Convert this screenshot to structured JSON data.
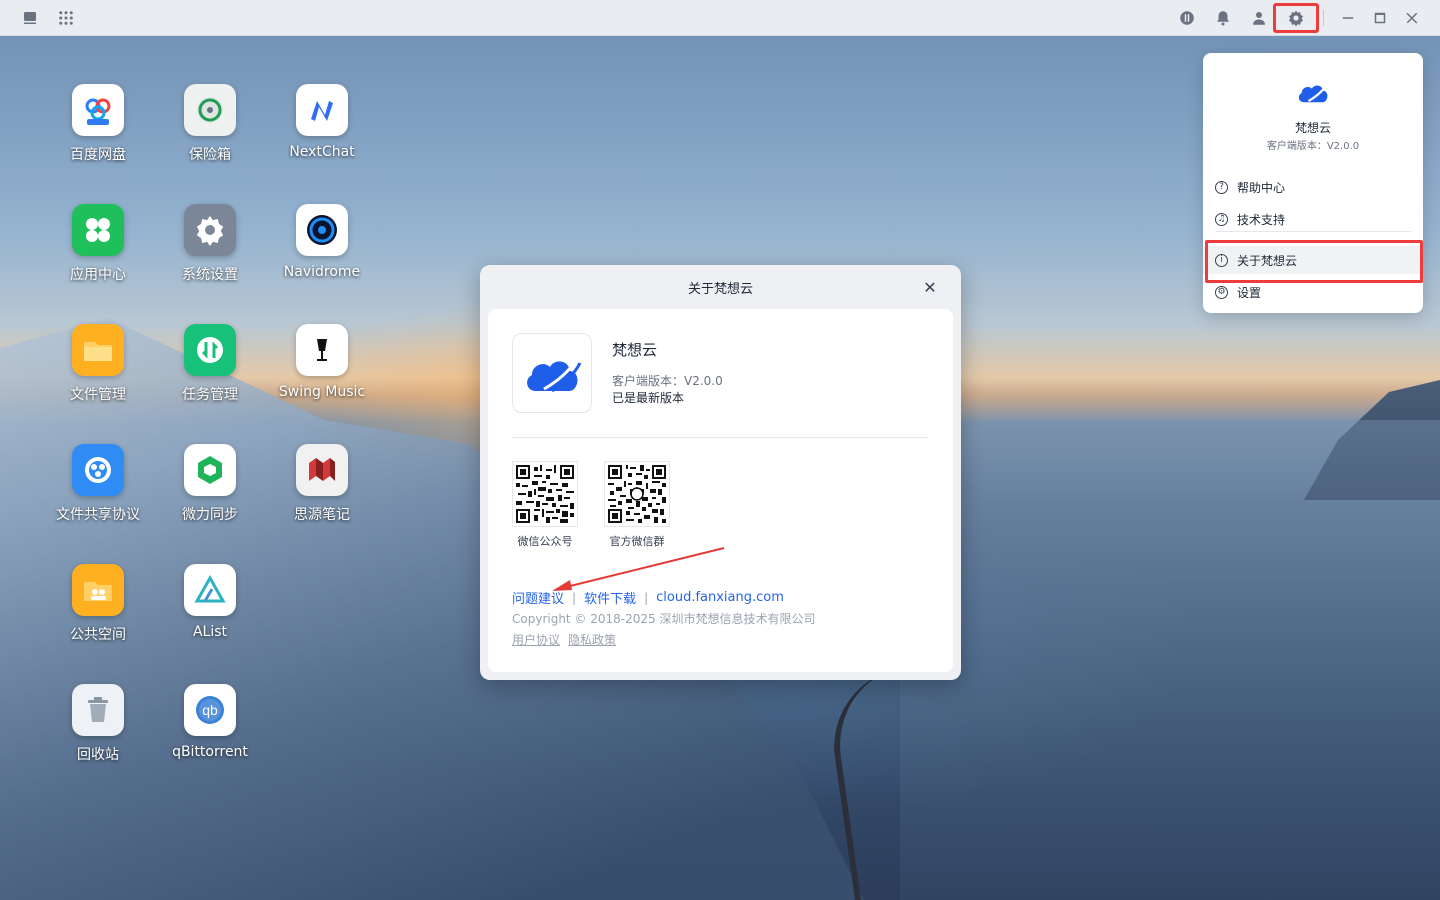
{
  "apps": [
    {
      "label": "百度网盘",
      "icon": "baidu-netdisk-icon",
      "color": "#ffffff"
    },
    {
      "label": "保险箱",
      "icon": "safe-icon",
      "color": "#eef1f0"
    },
    {
      "label": "NextChat",
      "icon": "nextchat-icon",
      "color": "#ffffff"
    },
    {
      "label": "应用中心",
      "icon": "app-center-icon",
      "color": "#1fbf5c"
    },
    {
      "label": "系统设置",
      "icon": "settings-gear-icon",
      "color": "#7b8796"
    },
    {
      "label": "Navidrome",
      "icon": "navidrome-icon",
      "color": "#ffffff"
    },
    {
      "label": "文件管理",
      "icon": "folder-icon",
      "color": "#ffb020"
    },
    {
      "label": "任务管理",
      "icon": "task-manager-icon",
      "color": "#18c17a"
    },
    {
      "label": "Swing Music",
      "icon": "swing-music-icon",
      "color": "#ffffff"
    },
    {
      "label": "文件共享协议",
      "icon": "file-share-icon",
      "color": "#2f8cf5"
    },
    {
      "label": "微力同步",
      "icon": "verysync-icon",
      "color": "#ffffff"
    },
    {
      "label": "思源笔记",
      "icon": "siyuan-icon",
      "color": "#f1f1f1"
    },
    {
      "label": "公共空间",
      "icon": "public-space-icon",
      "color": "#ffb020"
    },
    {
      "label": "AList",
      "icon": "alist-icon",
      "color": "#ffffff"
    },
    {
      "label": "回收站",
      "icon": "trash-icon",
      "color": "#eef1f5"
    },
    {
      "label": "qBittorrent",
      "icon": "qbittorrent-icon",
      "color": "#ffffff"
    }
  ],
  "dialog": {
    "title": "关于梵想云",
    "close": "✕",
    "app_name": "梵想云",
    "version": "客户端版本：V2.0.0",
    "latest": "已是最新版本",
    "qr": [
      {
        "label": "微信公众号"
      },
      {
        "label": "官方微信群"
      }
    ],
    "links": {
      "feedback": "问题建议",
      "download": "软件下载",
      "site": "cloud.fanxiang.com",
      "sep": "|"
    },
    "copyright": "Copyright © 2018-2025 深圳市梵想信息技术有限公司",
    "legal": {
      "agreement": "用户协议",
      "privacy": "隐私政策"
    }
  },
  "menu": {
    "app_name": "梵想云",
    "version": "客户端版本：V2.0.0",
    "items": [
      {
        "label": "帮助中心",
        "icon": "?"
      },
      {
        "label": "技术支持",
        "icon": "♫"
      },
      {
        "label": "关于梵想云",
        "icon": "i"
      },
      {
        "label": "设置",
        "icon": "⚙"
      }
    ]
  },
  "colors": {
    "accent": "#2563eb",
    "highlight": "#ee3b3b",
    "brand": "#1e5ee8"
  }
}
